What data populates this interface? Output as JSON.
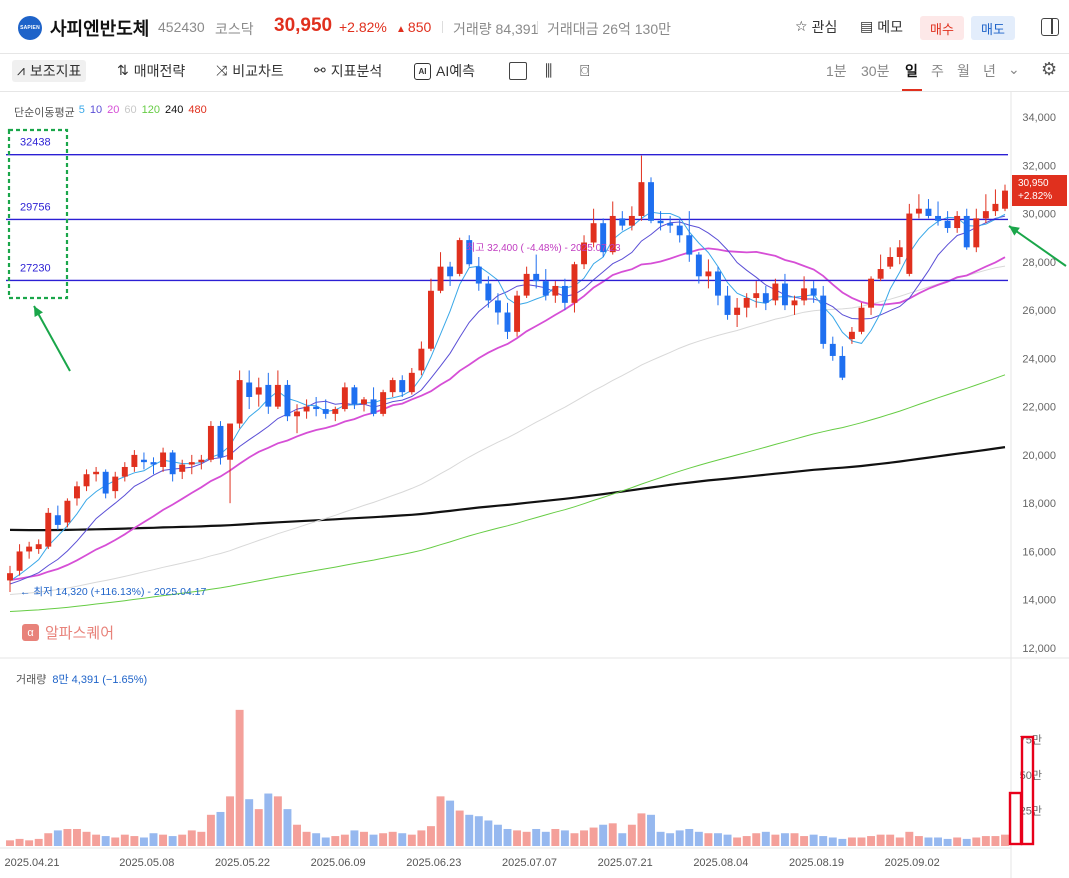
{
  "header": {
    "logo_text": "SAPIEN",
    "name": "사피엔반도체",
    "code": "452430",
    "market": "코스닥",
    "price": "30,950",
    "change_pct": "+2.82%",
    "change_amt": "850",
    "volume": "거래량 84,391",
    "trade_amount": "거래대금 26억 130만",
    "watch_label": "관심",
    "memo_label": "메모",
    "buy_label": "매수",
    "sell_label": "매도"
  },
  "toolbar": {
    "indicator_label": "보조지표",
    "strategy_label": "매매전략",
    "compare_label": "비교차트",
    "analysis_label": "지표분석",
    "ai_label": "AI예측",
    "periods": [
      "1분",
      "30분",
      "일",
      "주",
      "월",
      "년"
    ],
    "active_period": "일"
  },
  "legend": {
    "title": "단순이동평균",
    "items": [
      {
        "label": "5",
        "color": "#3aa8e8"
      },
      {
        "label": "10",
        "color": "#5b4fd6"
      },
      {
        "label": "20",
        "color": "#d64fd6"
      },
      {
        "label": "60",
        "color": "#c8c8c8"
      },
      {
        "label": "120",
        "color": "#66cc44"
      },
      {
        "label": "240",
        "color": "#111111"
      },
      {
        "label": "480",
        "color": "#e0301e"
      }
    ]
  },
  "volume_legend": {
    "label": "거래량",
    "value": "8만 4,391 (−1.65%)"
  },
  "watermark": {
    "text": "알파스퀘어",
    "icon": "alpha-icon"
  },
  "price_tag": {
    "price": "30,950",
    "pct": "+2.82%"
  },
  "colors": {
    "up": "#e0301e",
    "down": "#1e6ff0",
    "hline": "#2b1fd4",
    "box": "#1aa64a",
    "arrow": "#1aa64a",
    "highlight": "#e8001a"
  },
  "chart_data": {
    "type": "candlestick",
    "title": "",
    "y_axis": {
      "min": 12000,
      "max": 34000,
      "ticks": [
        "34,000",
        "32,000",
        "30,000",
        "28,000",
        "26,000",
        "24,000",
        "22,000",
        "20,000",
        "18,000",
        "16,000",
        "14,000",
        "12,000"
      ]
    },
    "volume_axis": {
      "ticks": [
        "75만",
        "50만",
        "25만"
      ]
    },
    "x_ticks": [
      "2025.04.21",
      "2025.05.08",
      "2025.05.22",
      "2025.06.09",
      "2025.06.23",
      "2025.07.07",
      "2025.07.21",
      "2025.08.04",
      "2025.08.19",
      "2025.09.02"
    ],
    "horizontal_levels": [
      {
        "label": "32438",
        "value": 32438
      },
      {
        "label": "29756",
        "value": 29756
      },
      {
        "label": "27230",
        "value": 27230
      }
    ],
    "annotations": {
      "high": "최고 32,400 ( -4.48%) - 2025.07.23",
      "low": "최저 14,320 (+116.13%) - 2025.04.17"
    },
    "candles": [
      [
        14800,
        15400,
        14320,
        15100
      ],
      [
        15200,
        16300,
        15000,
        16000
      ],
      [
        16000,
        16400,
        15700,
        16200
      ],
      [
        16100,
        16500,
        15900,
        16300
      ],
      [
        16200,
        17800,
        16100,
        17600
      ],
      [
        17500,
        17900,
        16900,
        17100
      ],
      [
        17200,
        18200,
        17000,
        18100
      ],
      [
        18200,
        18900,
        17900,
        18700
      ],
      [
        18700,
        19400,
        18500,
        19200
      ],
      [
        19200,
        19500,
        18900,
        19300
      ],
      [
        19300,
        19400,
        18200,
        18400
      ],
      [
        18500,
        19300,
        18200,
        19100
      ],
      [
        19100,
        19700,
        18900,
        19500
      ],
      [
        19500,
        20200,
        19300,
        20000
      ],
      [
        19800,
        20100,
        19400,
        19700
      ],
      [
        19700,
        19900,
        19200,
        19600
      ],
      [
        19500,
        20300,
        19300,
        20100
      ],
      [
        20100,
        20200,
        18900,
        19200
      ],
      [
        19300,
        19800,
        19000,
        19600
      ],
      [
        19600,
        20000,
        19200,
        19700
      ],
      [
        19700,
        20000,
        19400,
        19800
      ],
      [
        19800,
        21400,
        19700,
        21200
      ],
      [
        21200,
        21400,
        19600,
        19900
      ],
      [
        19800,
        21200,
        18000,
        21300
      ],
      [
        21300,
        23500,
        21100,
        23100
      ],
      [
        23000,
        23500,
        21900,
        22400
      ],
      [
        22500,
        23200,
        22000,
        22800
      ],
      [
        22900,
        23400,
        21700,
        22000
      ],
      [
        22000,
        23500,
        21900,
        22900
      ],
      [
        22900,
        23100,
        21400,
        21600
      ],
      [
        21600,
        22100,
        20900,
        21800
      ],
      [
        21800,
        22300,
        21500,
        22000
      ],
      [
        22000,
        22400,
        21600,
        21900
      ],
      [
        21900,
        22300,
        21500,
        21700
      ],
      [
        21700,
        22000,
        21400,
        21900
      ],
      [
        21900,
        23000,
        21800,
        22800
      ],
      [
        22800,
        22900,
        21900,
        22100
      ],
      [
        22100,
        22400,
        21800,
        22300
      ],
      [
        22300,
        22800,
        21600,
        21700
      ],
      [
        21700,
        22700,
        21600,
        22600
      ],
      [
        22600,
        23200,
        22400,
        23100
      ],
      [
        23100,
        23300,
        22400,
        22600
      ],
      [
        22600,
        23600,
        22500,
        23400
      ],
      [
        23500,
        24700,
        23300,
        24400
      ],
      [
        24400,
        27300,
        24300,
        26800
      ],
      [
        26800,
        28400,
        26700,
        27800
      ],
      [
        27800,
        28000,
        27000,
        27400
      ],
      [
        27500,
        29000,
        27400,
        28900
      ],
      [
        28900,
        29100,
        27800,
        27900
      ],
      [
        27800,
        28200,
        26800,
        27100
      ],
      [
        27100,
        27400,
        26100,
        26400
      ],
      [
        26400,
        26700,
        25400,
        25900
      ],
      [
        25900,
        26300,
        24800,
        25100
      ],
      [
        25100,
        26800,
        24900,
        26600
      ],
      [
        26600,
        27800,
        26500,
        27500
      ],
      [
        27500,
        28300,
        26900,
        27200
      ],
      [
        27200,
        27700,
        26400,
        26600
      ],
      [
        26600,
        27200,
        26300,
        27000
      ],
      [
        27000,
        27300,
        26000,
        26300
      ],
      [
        26300,
        28000,
        25900,
        27900
      ],
      [
        27900,
        29100,
        27700,
        28800
      ],
      [
        28800,
        30200,
        28600,
        29600
      ],
      [
        29600,
        29800,
        28200,
        28400
      ],
      [
        28400,
        30500,
        28300,
        29900
      ],
      [
        29800,
        30100,
        29300,
        29500
      ],
      [
        29500,
        30300,
        29300,
        29900
      ],
      [
        29900,
        32400,
        29700,
        31300
      ],
      [
        31300,
        31500,
        29600,
        29700
      ],
      [
        29700,
        30100,
        29300,
        29600
      ],
      [
        29600,
        29900,
        29200,
        29500
      ],
      [
        29500,
        29800,
        28800,
        29100
      ],
      [
        29100,
        30100,
        28000,
        28300
      ],
      [
        28300,
        28400,
        27100,
        27400
      ],
      [
        27400,
        28100,
        26900,
        27600
      ],
      [
        27600,
        27800,
        26200,
        26600
      ],
      [
        26600,
        27000,
        25600,
        25800
      ],
      [
        25800,
        26500,
        25300,
        26100
      ],
      [
        26100,
        26700,
        25700,
        26500
      ],
      [
        26500,
        27200,
        26100,
        26700
      ],
      [
        26700,
        27000,
        26000,
        26300
      ],
      [
        26400,
        27300,
        26200,
        27100
      ],
      [
        27100,
        27500,
        26000,
        26200
      ],
      [
        26200,
        26600,
        25800,
        26400
      ],
      [
        26400,
        27400,
        26200,
        26900
      ],
      [
        26900,
        27200,
        26300,
        26600
      ],
      [
        26600,
        27000,
        24400,
        24600
      ],
      [
        24600,
        24900,
        23900,
        24100
      ],
      [
        24100,
        24500,
        23100,
        23200
      ],
      [
        24800,
        25300,
        24600,
        25100
      ],
      [
        25100,
        26300,
        25000,
        26100
      ],
      [
        26100,
        27400,
        25800,
        27300
      ],
      [
        27300,
        28300,
        27200,
        27700
      ],
      [
        27800,
        28600,
        27700,
        28200
      ],
      [
        28200,
        28900,
        27900,
        28600
      ],
      [
        27500,
        30400,
        27400,
        30000
      ],
      [
        30000,
        30800,
        29800,
        30200
      ],
      [
        30200,
        30600,
        29800,
        29900
      ],
      [
        29900,
        30500,
        29500,
        29700
      ],
      [
        29700,
        30100,
        29200,
        29400
      ],
      [
        29400,
        30100,
        29200,
        29900
      ],
      [
        29900,
        30200,
        28500,
        28600
      ],
      [
        28600,
        30200,
        28400,
        29800
      ],
      [
        29800,
        30800,
        29600,
        30100
      ],
      [
        30100,
        31000,
        29900,
        30400
      ],
      [
        30200,
        31200,
        30100,
        30950
      ]
    ],
    "volumes": [
      4,
      5,
      4,
      5,
      9,
      11,
      12,
      12,
      10,
      8,
      7,
      6,
      8,
      7,
      6,
      9,
      8,
      7,
      8,
      11,
      10,
      22,
      24,
      35,
      96,
      33,
      26,
      37,
      35,
      26,
      15,
      10,
      9,
      6,
      7,
      8,
      11,
      10,
      8,
      9,
      10,
      9,
      8,
      11,
      14,
      35,
      32,
      25,
      22,
      21,
      18,
      15,
      12,
      11,
      10,
      12,
      10,
      12,
      11,
      9,
      11,
      13,
      15,
      16,
      9,
      15,
      23,
      22,
      10,
      9,
      11,
      12,
      10,
      9,
      9,
      8,
      6,
      7,
      9,
      10,
      8,
      9,
      9,
      7,
      8,
      7,
      6,
      5,
      6,
      6,
      7,
      8,
      8,
      6,
      10,
      7,
      6,
      6,
      5,
      6,
      5,
      6,
      7,
      7,
      8
    ]
  }
}
